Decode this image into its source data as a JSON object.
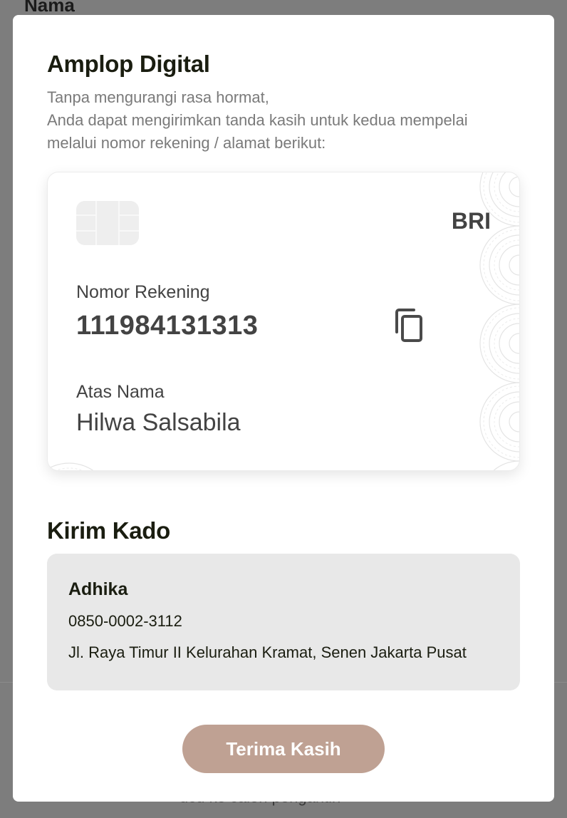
{
  "background": {
    "top_heading": "Nama",
    "footer_text": "ucu ke calon pengantin"
  },
  "modal": {
    "title": "Amplop Digital",
    "description_lines": [
      "Tanpa mengurangi rasa hormat,",
      "Anda dapat mengirimkan tanda kasih untuk kedua mempelai",
      "melalui nomor rekening / alamat berikut:"
    ],
    "card": {
      "bank": "BRI",
      "account_label": "Nomor Rekening",
      "account_number": "111984131313",
      "name_label": "Atas Nama",
      "account_name": "Hilwa Salsabila",
      "copy_icon": "copy-icon",
      "chip_icon": "card-chip-icon"
    },
    "gift": {
      "title": "Kirim Kado",
      "recipient": "Adhika",
      "phone": "0850-0002-3112",
      "address": "Jl. Raya Timur II Kelurahan Kramat, Senen Jakarta Pusat"
    },
    "close_button": "Terima Kasih"
  },
  "colors": {
    "overlay": "#7d7d7d",
    "button": "#bfa193",
    "gift_box": "#e8e8e8",
    "heading": "#1a1d10",
    "card_text": "#434343"
  }
}
